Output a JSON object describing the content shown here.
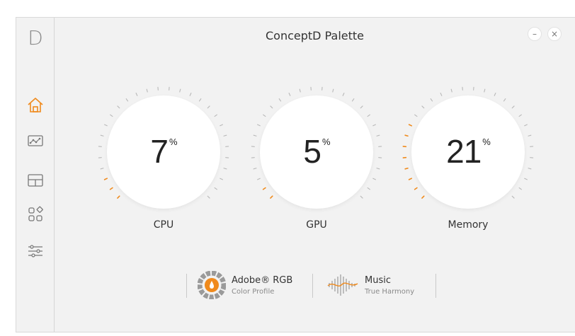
{
  "app": {
    "title": "ConceptD Palette",
    "logo": "D",
    "accent": "#f08a1c",
    "minimize_icon": "–",
    "close_icon": "×"
  },
  "sidebar": {
    "items": [
      {
        "icon": "home-icon",
        "active": true
      },
      {
        "icon": "display-graph-icon",
        "active": false
      },
      {
        "icon": "layout-icon",
        "active": false
      },
      {
        "icon": "apps-icon",
        "active": false
      },
      {
        "icon": "sliders-icon",
        "active": false
      }
    ]
  },
  "gauges": [
    {
      "label": "CPU",
      "value": "7",
      "unit": "%",
      "percent": 7
    },
    {
      "label": "GPU",
      "value": "5",
      "unit": "%",
      "percent": 5
    },
    {
      "label": "Memory",
      "value": "21",
      "unit": "%",
      "percent": 21
    }
  ],
  "profiles": {
    "color": {
      "name": "Adobe® RGB",
      "sub": "Color Profile",
      "icon": "color-wheel-icon"
    },
    "audio": {
      "name": "Music",
      "sub": "True Harmony",
      "icon": "sound-wave-icon"
    }
  }
}
